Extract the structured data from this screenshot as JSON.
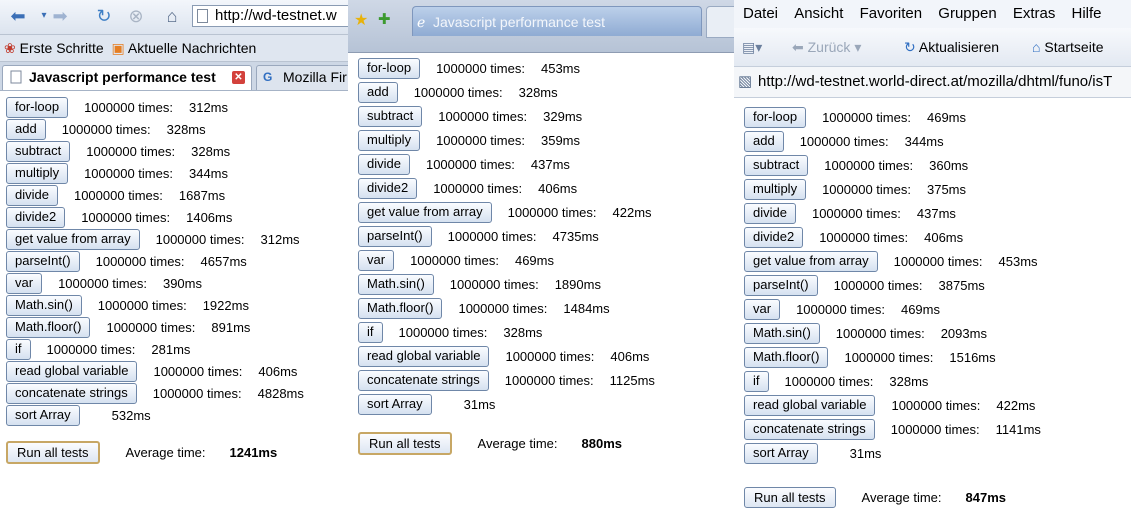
{
  "firefox": {
    "url": "http://wd-testnet.w",
    "bookmarks": [
      "Erste Schritte",
      "Aktuelle Nachrichten"
    ],
    "tabs": [
      "Javascript performance test",
      "Mozilla Fir"
    ]
  },
  "safari": {
    "tab_title": "Javascript performance test"
  },
  "ie": {
    "menu": [
      "Datei",
      "Ansicht",
      "Favoriten",
      "Gruppen",
      "Extras",
      "Hilfe"
    ],
    "back_label": "Zurück",
    "refresh_label": "Aktualisieren",
    "home_label": "Startseite",
    "address": "http://wd-testnet.world-direct.at/mozilla/dhtml/funo/isT"
  },
  "run_all_label": "Run all tests",
  "avg_label": "Average time:",
  "panes": [
    {
      "tests": [
        {
          "label": "for-loop",
          "times": "1000000 times:",
          "ms": "312ms"
        },
        {
          "label": "add",
          "times": "1000000 times:",
          "ms": "328ms"
        },
        {
          "label": "subtract",
          "times": "1000000 times:",
          "ms": "328ms"
        },
        {
          "label": "multiply",
          "times": "1000000 times:",
          "ms": "344ms"
        },
        {
          "label": "divide",
          "times": "1000000 times:",
          "ms": "1687ms"
        },
        {
          "label": "divide2",
          "times": "1000000 times:",
          "ms": "1406ms"
        },
        {
          "label": "get value from array",
          "times": "1000000 times:",
          "ms": "312ms"
        },
        {
          "label": "parseInt()",
          "times": "1000000 times:",
          "ms": "4657ms"
        },
        {
          "label": "var",
          "times": "1000000 times:",
          "ms": "390ms"
        },
        {
          "label": "Math.sin()",
          "times": "1000000 times:",
          "ms": "1922ms"
        },
        {
          "label": "Math.floor()",
          "times": "1000000 times:",
          "ms": "891ms"
        },
        {
          "label": "if",
          "times": "1000000 times:",
          "ms": "281ms"
        },
        {
          "label": "read global variable",
          "times": "1000000 times:",
          "ms": "406ms"
        },
        {
          "label": "concatenate strings",
          "times": "1000000 times:",
          "ms": "4828ms"
        },
        {
          "label": "sort Array",
          "times": "",
          "ms": "532ms"
        }
      ],
      "average": "1241ms"
    },
    {
      "tests": [
        {
          "label": "for-loop",
          "times": "1000000 times:",
          "ms": "453ms"
        },
        {
          "label": "add",
          "times": "1000000 times:",
          "ms": "328ms"
        },
        {
          "label": "subtract",
          "times": "1000000 times:",
          "ms": "329ms"
        },
        {
          "label": "multiply",
          "times": "1000000 times:",
          "ms": "359ms"
        },
        {
          "label": "divide",
          "times": "1000000 times:",
          "ms": "437ms"
        },
        {
          "label": "divide2",
          "times": "1000000 times:",
          "ms": "406ms"
        },
        {
          "label": "get value from array",
          "times": "1000000 times:",
          "ms": "422ms"
        },
        {
          "label": "parseInt()",
          "times": "1000000 times:",
          "ms": "4735ms"
        },
        {
          "label": "var",
          "times": "1000000 times:",
          "ms": "469ms"
        },
        {
          "label": "Math.sin()",
          "times": "1000000 times:",
          "ms": "1890ms"
        },
        {
          "label": "Math.floor()",
          "times": "1000000 times:",
          "ms": "1484ms"
        },
        {
          "label": "if",
          "times": "1000000 times:",
          "ms": "328ms"
        },
        {
          "label": "read global variable",
          "times": "1000000 times:",
          "ms": "406ms"
        },
        {
          "label": "concatenate strings",
          "times": "1000000 times:",
          "ms": "1125ms"
        },
        {
          "label": "sort Array",
          "times": "",
          "ms": "31ms"
        }
      ],
      "average": "880ms"
    },
    {
      "tests": [
        {
          "label": "for-loop",
          "times": "1000000 times:",
          "ms": "469ms"
        },
        {
          "label": "add",
          "times": "1000000 times:",
          "ms": "344ms"
        },
        {
          "label": "subtract",
          "times": "1000000 times:",
          "ms": "360ms"
        },
        {
          "label": "multiply",
          "times": "1000000 times:",
          "ms": "375ms"
        },
        {
          "label": "divide",
          "times": "1000000 times:",
          "ms": "437ms"
        },
        {
          "label": "divide2",
          "times": "1000000 times:",
          "ms": "406ms"
        },
        {
          "label": "get value from array",
          "times": "1000000 times:",
          "ms": "453ms"
        },
        {
          "label": "parseInt()",
          "times": "1000000 times:",
          "ms": "3875ms"
        },
        {
          "label": "var",
          "times": "1000000 times:",
          "ms": "469ms"
        },
        {
          "label": "Math.sin()",
          "times": "1000000 times:",
          "ms": "2093ms"
        },
        {
          "label": "Math.floor()",
          "times": "1000000 times:",
          "ms": "1516ms"
        },
        {
          "label": "if",
          "times": "1000000 times:",
          "ms": "328ms"
        },
        {
          "label": "read global variable",
          "times": "1000000 times:",
          "ms": "422ms"
        },
        {
          "label": "concatenate strings",
          "times": "1000000 times:",
          "ms": "1141ms"
        },
        {
          "label": "sort Array",
          "times": "",
          "ms": "31ms"
        }
      ],
      "average": "847ms"
    }
  ]
}
